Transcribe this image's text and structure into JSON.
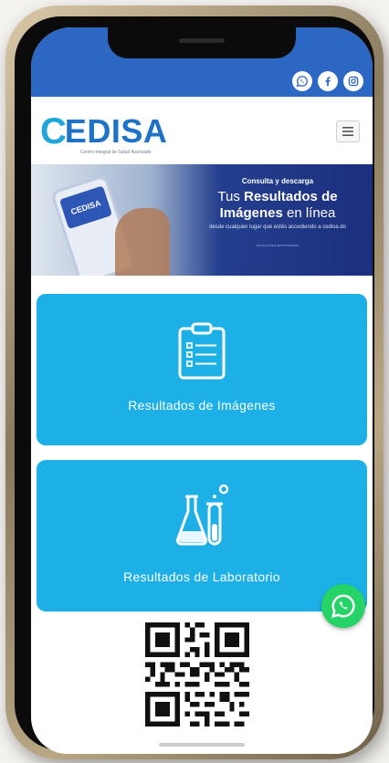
{
  "social": {
    "icons": [
      "whatsapp-icon",
      "facebook-icon",
      "instagram-icon"
    ]
  },
  "header": {
    "logo_text": "EDISA",
    "logo_mark": "C",
    "tagline": "Centro Integral de Salud Avanzado",
    "menu_icon": "hamburger-icon"
  },
  "banner": {
    "subtitle": "Consulta y descarga",
    "title_prefix": "Tus ",
    "title_bold": "Resultados de",
    "title_line2_bold": "Imágenes",
    "title_line2_rest": " en línea",
    "small_text": "desde cualquier lugar que estés accediendo a cedisa.do",
    "url": "www.cedisa.do/resultados",
    "phone_logo": "CEDISA"
  },
  "cards": [
    {
      "label": "Resultados de Imágenes",
      "icon": "clipboard-icon"
    },
    {
      "label": "Resultados de Laboratorio",
      "icon": "lab-flask-icon"
    }
  ],
  "floating": {
    "icon": "whatsapp-icon"
  },
  "colors": {
    "topbar": "#2b67c3",
    "brand_blue": "#1f73c6",
    "card": "#1cb0e6",
    "whatsapp": "#25d366"
  }
}
